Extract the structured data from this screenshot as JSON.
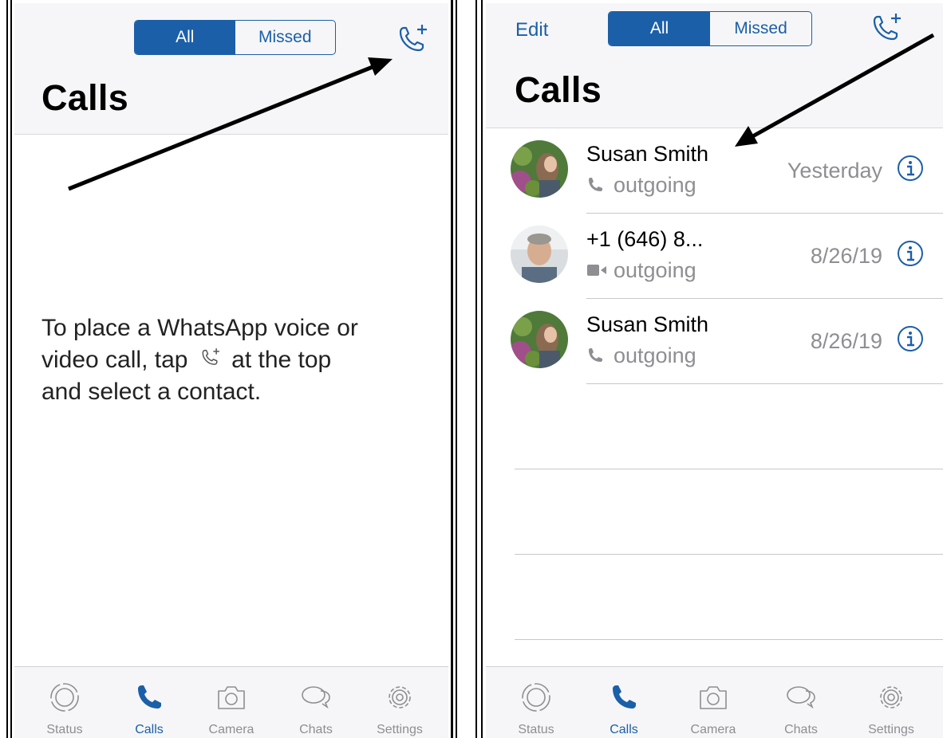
{
  "left_screen": {
    "segment": {
      "all_label": "All",
      "missed_label": "Missed",
      "selected": "All"
    },
    "title": "Calls",
    "empty_state": {
      "line1": "To place a WhatsApp voice or",
      "line2_before": "video call, tap",
      "line2_after": "at the top",
      "line3": "and select a contact."
    },
    "tabbar": {
      "status": "Status",
      "calls": "Calls",
      "camera": "Camera",
      "chats": "Chats",
      "settings": "Settings",
      "active": "Calls"
    }
  },
  "right_screen": {
    "edit_label": "Edit",
    "segment": {
      "all_label": "All",
      "missed_label": "Missed",
      "selected": "All"
    },
    "title": "Calls",
    "calls": [
      {
        "name": "Susan Smith",
        "type": "voice",
        "direction": "outgoing",
        "date": "Yesterday"
      },
      {
        "name": "+1 (646) 8...",
        "type": "video",
        "direction": "outgoing",
        "date": "8/26/19"
      },
      {
        "name": "Susan Smith",
        "type": "voice",
        "direction": "outgoing",
        "date": "8/26/19"
      }
    ],
    "tabbar": {
      "status": "Status",
      "calls": "Calls",
      "camera": "Camera",
      "chats": "Chats",
      "settings": "Settings",
      "active": "Calls"
    }
  },
  "icons": {
    "new_call": "phone-plus-icon",
    "status": "status-rings-icon",
    "calls": "phone-icon",
    "camera": "camera-icon",
    "chats": "chat-bubbles-icon",
    "settings": "gear-icon",
    "info": "info-circle-icon",
    "voice": "phone-small-icon",
    "video": "video-camera-icon"
  },
  "colors": {
    "accent": "#1b5fa8",
    "secondary_text": "#8e8e93",
    "header_bg": "#f6f6f8"
  }
}
